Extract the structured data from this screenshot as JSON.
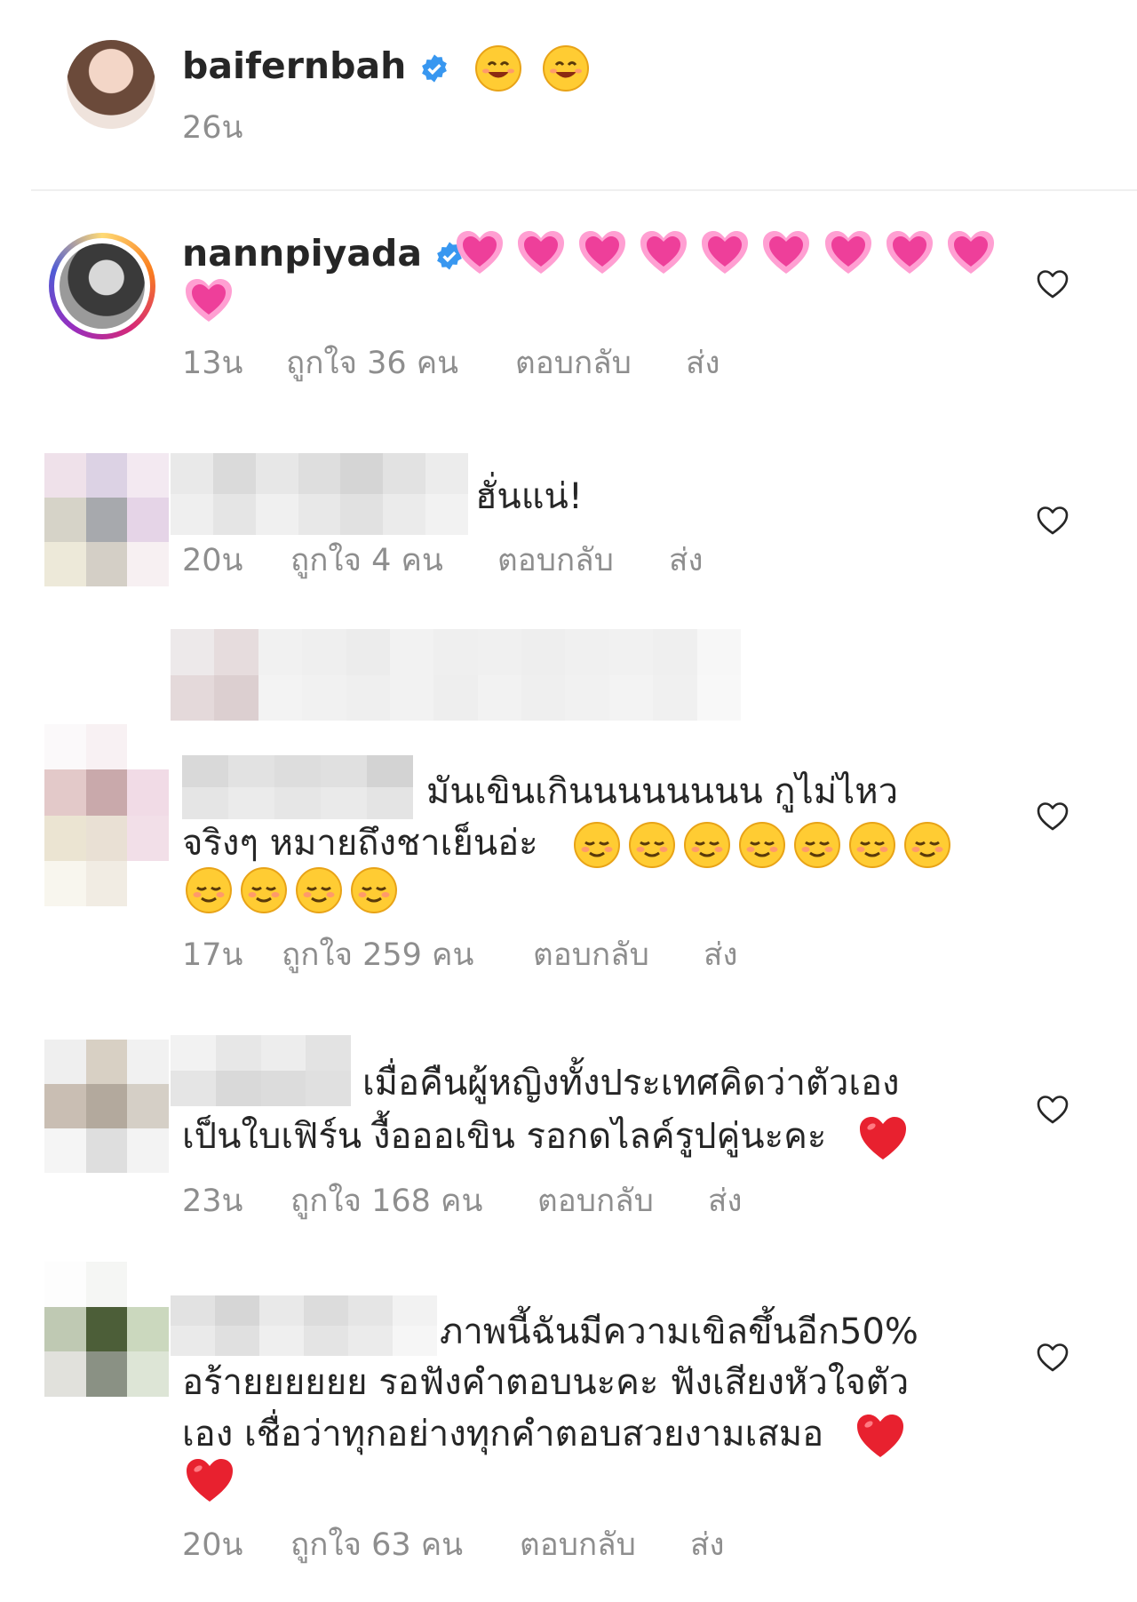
{
  "post": {
    "username": "baifernbah",
    "time": "26น"
  },
  "comments": [
    {
      "username": "nannpiyada",
      "time": "13น",
      "likes": "ถูกใจ 36 คน",
      "reply": "ตอบกลับ",
      "send": "ส่ง"
    },
    {
      "text": "ฮั่นแน่!",
      "time": "20น",
      "likes": "ถูกใจ 4 คน",
      "reply": "ตอบกลับ",
      "send": "ส่ง"
    },
    {
      "text_line1": "มันเขินเกินนนนนนนน กูไม่ไหว",
      "text_line2": "จริงๆ หมายถึงชาเย็นอ่ะ",
      "time": "17น",
      "likes": "ถูกใจ 259 คน",
      "reply": "ตอบกลับ",
      "send": "ส่ง"
    },
    {
      "text_line1": "เมื่อคืนผู้หญิงทั้งประเทศคิดว่าตัวเอง",
      "text_line2": "เป็นใบเฟิร์น งื้อออเขิน รอกดไลค์รูปคู่นะคะ",
      "time": "23น",
      "likes": "ถูกใจ 168 คน",
      "reply": "ตอบกลับ",
      "send": "ส่ง"
    },
    {
      "text_line1": "ภาพนี้ฉันมีความเขิลขึ้นอีก50%",
      "text_line2": "อร้ายยยยยย รอฟังคำตอบนะคะ ฟังเสียงหัวใจตัว",
      "text_line3": "เอง เชื่อว่าทุกอย่างทุกคำตอบสวยงามเสมอ",
      "time": "20น",
      "likes": "ถูกใจ 63 คน",
      "reply": "ตอบกลับ",
      "send": "ส่ง"
    }
  ],
  "icons": {
    "like": "heart-outline-icon",
    "verified": "verified-badge-icon",
    "smile": "smiling-face-emoji",
    "pink_heart": "growing-heart-emoji",
    "blush": "relieved-face-emoji",
    "red_heart": "red-heart-emoji"
  },
  "colors": {
    "text": "#262626",
    "meta": "#8e8e8e",
    "verified": "#3897f0",
    "divider": "#efefef"
  }
}
